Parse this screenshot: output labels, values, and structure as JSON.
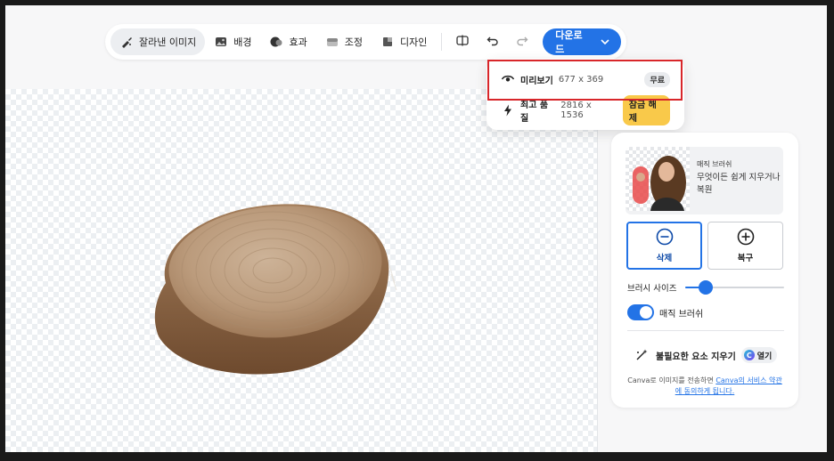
{
  "toolbar": {
    "cutout_label": "잘라낸 이미지",
    "background_label": "배경",
    "effects_label": "효과",
    "adjust_label": "조정",
    "design_label": "디자인",
    "download_label": "다운로드"
  },
  "download_menu": {
    "preview_label": "미리보기",
    "preview_dims": "677 x 369",
    "preview_badge": "무료",
    "hq_label": "최고 품질",
    "hq_dims": "2816 x 1536",
    "hq_badge": "잠금 해제"
  },
  "panel": {
    "magic_brush_title": "매직 브러쉬",
    "magic_brush_desc": "무엇이든 쉽게 지우거나 복원",
    "erase_label": "삭제",
    "restore_label": "복구",
    "brush_size_label": "브러시 사이즈",
    "brush_size_fraction": 0.2,
    "toggle_label": "매직 브러쉬",
    "toggle_on": true,
    "magic_erase_label": "불필요한 요소 지우기",
    "open_label": "열기",
    "open_icon_letter": "C",
    "legal_prefix": "Canva로 이미지를 전송하면 ",
    "legal_link": "Canva의 서비스 약관 에 동의하게 됩니다."
  },
  "colors": {
    "accent": "#2373e6",
    "highlight": "#d8262a",
    "unlock_badge": "#f9c94a"
  }
}
